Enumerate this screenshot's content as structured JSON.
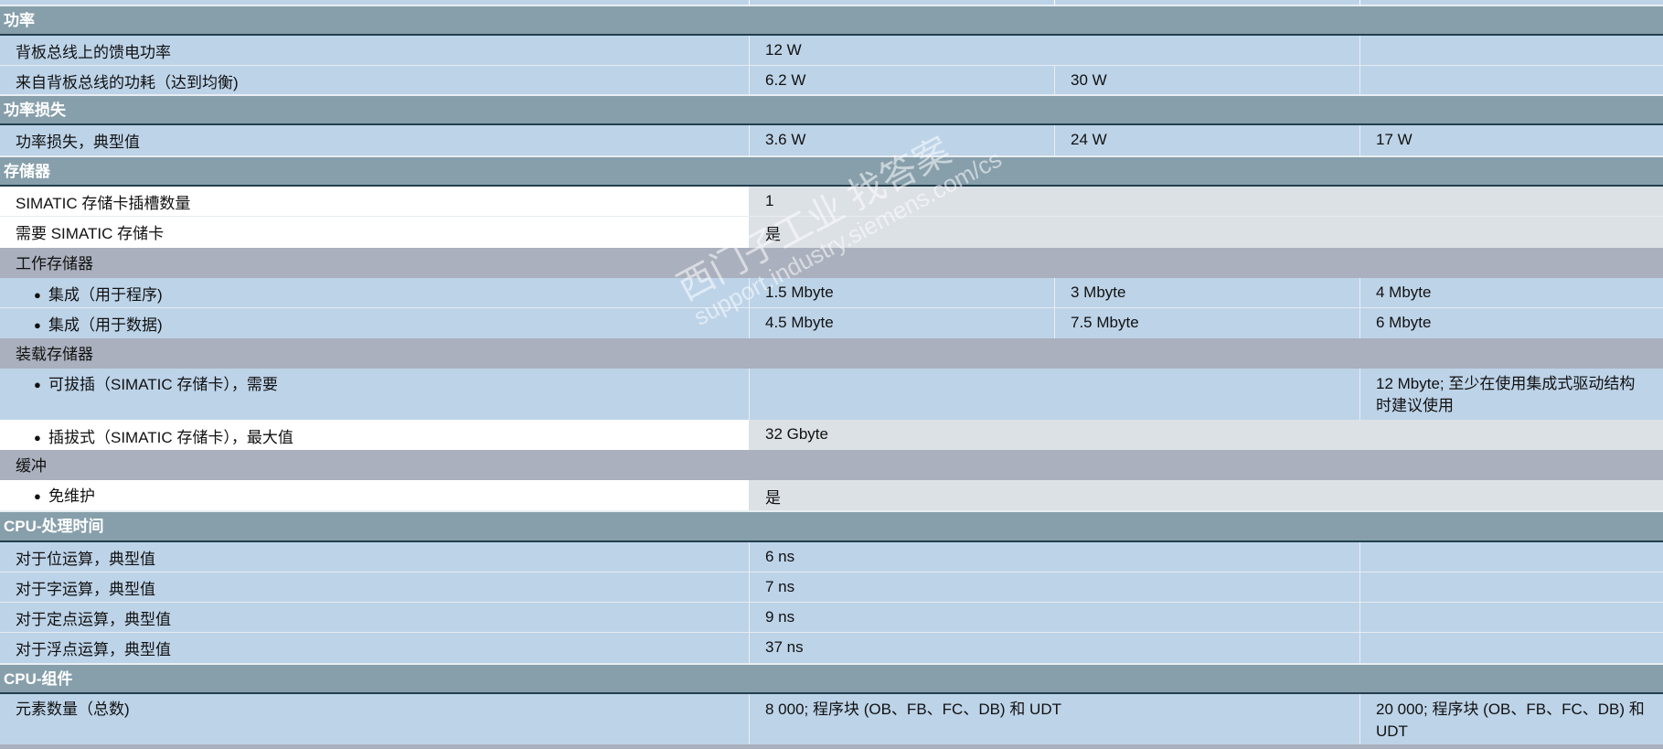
{
  "sections": {
    "power": "功率",
    "power_loss": "功率损失",
    "memory": "存储器",
    "cpu_time": "CPU-处理时间",
    "cpu_blocks": "CPU-组件"
  },
  "rows": {
    "feed_power": {
      "label": "背板总线上的馈电功率",
      "v1": "12 W"
    },
    "consumption": {
      "label": "来自背板总线的功耗（达到均衡)",
      "v1": "6.2 W",
      "v2": "30 W"
    },
    "loss_typ": {
      "label": "功率损失，典型值",
      "v1": "3.6 W",
      "v2": "24 W",
      "v3": "17 W"
    },
    "card_slots": {
      "label": "SIMATIC 存储卡插槽数量",
      "v1": "1"
    },
    "card_required": {
      "label": "需要 SIMATIC 存储卡",
      "v1": "是"
    },
    "work_mem": {
      "label": "工作存储器"
    },
    "integ_prog": {
      "label": "集成（用于程序)",
      "v1": "1.5 Mbyte",
      "v2": "3 Mbyte",
      "v3": "4 Mbyte"
    },
    "integ_data": {
      "label": "集成（用于数据)",
      "v1": "4.5 Mbyte",
      "v2": "7.5 Mbyte",
      "v3": "6 Mbyte"
    },
    "load_mem": {
      "label": "装载存储器"
    },
    "pluggable_req": {
      "label": "可拔插（SIMATIC 存储卡），需要",
      "v3": "12 Mbyte; 至少在使用集成式驱动结构时建议使用"
    },
    "pluggable_max": {
      "label": "插拔式（SIMATIC 存储卡），最大值",
      "v1": "32 Gbyte"
    },
    "buffer": {
      "label": "缓冲"
    },
    "maint_free": {
      "label": "免维护",
      "v1": "是"
    },
    "bit_op": {
      "label": "对于位运算，典型值",
      "v1": "6 ns"
    },
    "word_op": {
      "label": "对于字运算，典型值",
      "v1": "7 ns"
    },
    "fixed_op": {
      "label": "对于定点运算，典型值",
      "v1": "9 ns"
    },
    "float_op": {
      "label": "对于浮点运算，典型值",
      "v1": "37 ns"
    },
    "elements": {
      "label": "元素数量（总数)",
      "v1": "8 000; 程序块 (OB、FB、FC、DB) 和 UDT",
      "v3": "20 000; 程序块 (OB、FB、FC、DB) 和 UDT"
    }
  },
  "watermark": {
    "line1": "西门子工业  找答案",
    "line2": "support.industry.siemens.com/cs"
  },
  "colors": {
    "section_bg": "#879fab",
    "row_blue": "#bdd3e8",
    "subheader_gray": "#aab0bd",
    "cell_gray": "#dce1e6"
  }
}
